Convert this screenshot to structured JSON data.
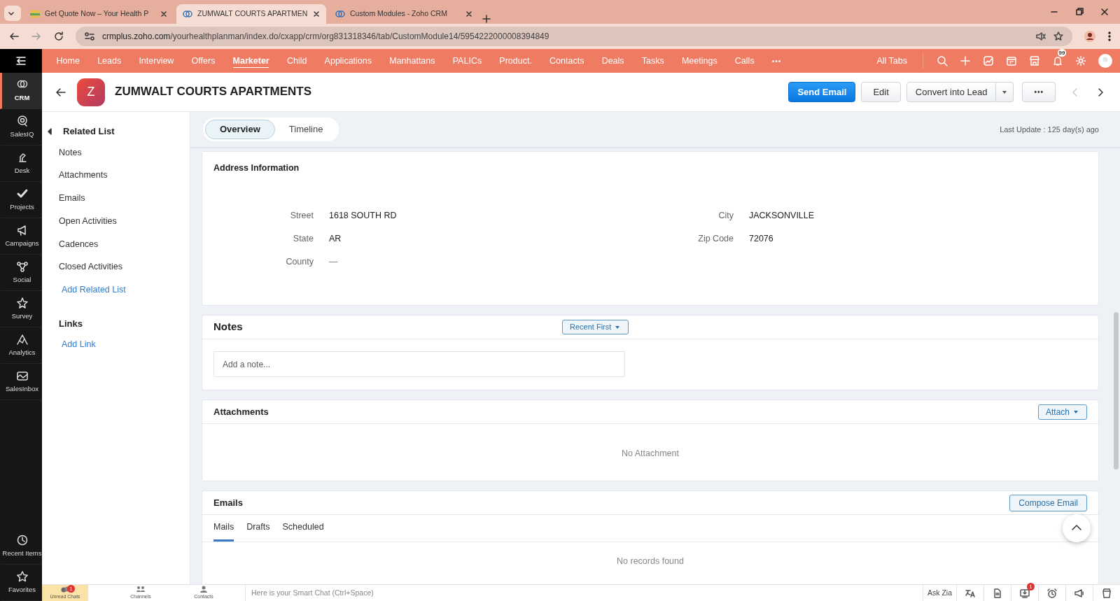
{
  "browser": {
    "tabs": [
      {
        "title": "Get Quote Now – Your Health P",
        "selected": false,
        "kind": "site"
      },
      {
        "title": "ZUMWALT COURTS APARTMEN",
        "selected": true,
        "kind": "crm"
      },
      {
        "title": "Custom Modules - Zoho CRM",
        "selected": false,
        "kind": "crm"
      }
    ],
    "url_host": "crmplus.zoho.com",
    "url_path": "/yourhealthplanman/index.do/cxapp/crm/org831318346/tab/CustomModule14/5954222000008394849"
  },
  "apps": [
    {
      "label": "CRM",
      "kind": "crm",
      "selected": true
    },
    {
      "label": "SalesIQ",
      "kind": "salesiq",
      "selected": false
    },
    {
      "label": "Desk",
      "kind": "desk",
      "selected": false
    },
    {
      "label": "Projects",
      "kind": "projects",
      "selected": false
    },
    {
      "label": "Campaigns",
      "kind": "campaigns",
      "selected": false
    },
    {
      "label": "Social",
      "kind": "social",
      "selected": false
    },
    {
      "label": "Survey",
      "kind": "survey",
      "selected": false
    },
    {
      "label": "Analytics",
      "kind": "analytics",
      "selected": false
    },
    {
      "label": "SalesInbox",
      "kind": "salesinbox",
      "selected": false
    }
  ],
  "bottom_apps": [
    {
      "label": "Recent Items",
      "kind": "recent"
    },
    {
      "label": "Favorites",
      "kind": "favorites"
    }
  ],
  "top_nav": {
    "items": [
      {
        "label": "Home",
        "selected": false
      },
      {
        "label": "Leads",
        "selected": false
      },
      {
        "label": "Interview",
        "selected": false
      },
      {
        "label": "Offers",
        "selected": false
      },
      {
        "label": "Marketer",
        "selected": true
      },
      {
        "label": "Child",
        "selected": false
      },
      {
        "label": "Applications",
        "selected": false
      },
      {
        "label": "Manhattans",
        "selected": false
      },
      {
        "label": "PALICs",
        "selected": false
      },
      {
        "label": "Product.",
        "selected": false
      },
      {
        "label": "Contacts",
        "selected": false
      },
      {
        "label": "Deals",
        "selected": false
      },
      {
        "label": "Tasks",
        "selected": false
      },
      {
        "label": "Meetings",
        "selected": false
      },
      {
        "label": "Calls",
        "selected": false
      }
    ],
    "more": "•••",
    "all_tabs": "All Tabs",
    "notification_count": "99"
  },
  "record": {
    "avatar": "Z",
    "title": "ZUMWALT COURTS APARTMENTS",
    "send_email": "Send Email",
    "edit": "Edit",
    "convert": "Convert into Lead",
    "more": "•••",
    "previous_enabled": false,
    "next_enabled": true
  },
  "related_list": {
    "title": "Related List",
    "items": [
      "Notes",
      "Attachments",
      "Emails",
      "Open Activities",
      "Cadences",
      "Closed Activities"
    ],
    "add": "Add Related List"
  },
  "links": {
    "title": "Links",
    "add": "Add Link"
  },
  "view_tabs": [
    {
      "label": "Overview",
      "selected": true
    },
    {
      "label": "Timeline",
      "selected": false
    }
  ],
  "last_update": "Last Update : 125 day(s) ago",
  "address": {
    "title": "Address Information",
    "left": [
      {
        "label": "Street",
        "value": "1618 SOUTH RD"
      },
      {
        "label": "State",
        "value": "AR"
      },
      {
        "label": "County",
        "value": "—"
      }
    ],
    "right": [
      {
        "label": "City",
        "value": "JACKSONVILLE"
      },
      {
        "label": "Zip Code",
        "value": "72076"
      }
    ]
  },
  "notes": {
    "title": "Notes",
    "sort": "Recent First",
    "placeholder": "Add a note..."
  },
  "attachments": {
    "title": "Attachments",
    "action": "Attach",
    "empty": "No Attachment"
  },
  "emails": {
    "title": "Emails",
    "action": "Compose Email",
    "tabs": [
      {
        "label": "Mails",
        "selected": true
      },
      {
        "label": "Drafts",
        "selected": false
      },
      {
        "label": "Scheduled",
        "selected": false
      }
    ],
    "empty": "No records found"
  },
  "bottom_bar": {
    "chat_tabs": [
      {
        "label": "Unread Chats",
        "kind": "chats",
        "selected": true,
        "badge": "1"
      },
      {
        "label": "Channels",
        "kind": "channels",
        "selected": false
      },
      {
        "label": "Contacts",
        "kind": "contacts",
        "selected": false
      }
    ],
    "smart_chat": "Here is your Smart Chat (Ctrl+Space)",
    "ask_zia": "Ask Zia",
    "tools": [
      {
        "kind": "translate"
      },
      {
        "kind": "document"
      },
      {
        "kind": "download",
        "badge": "1"
      },
      {
        "kind": "alarm"
      },
      {
        "kind": "megaphone"
      },
      {
        "kind": "cup"
      }
    ]
  }
}
